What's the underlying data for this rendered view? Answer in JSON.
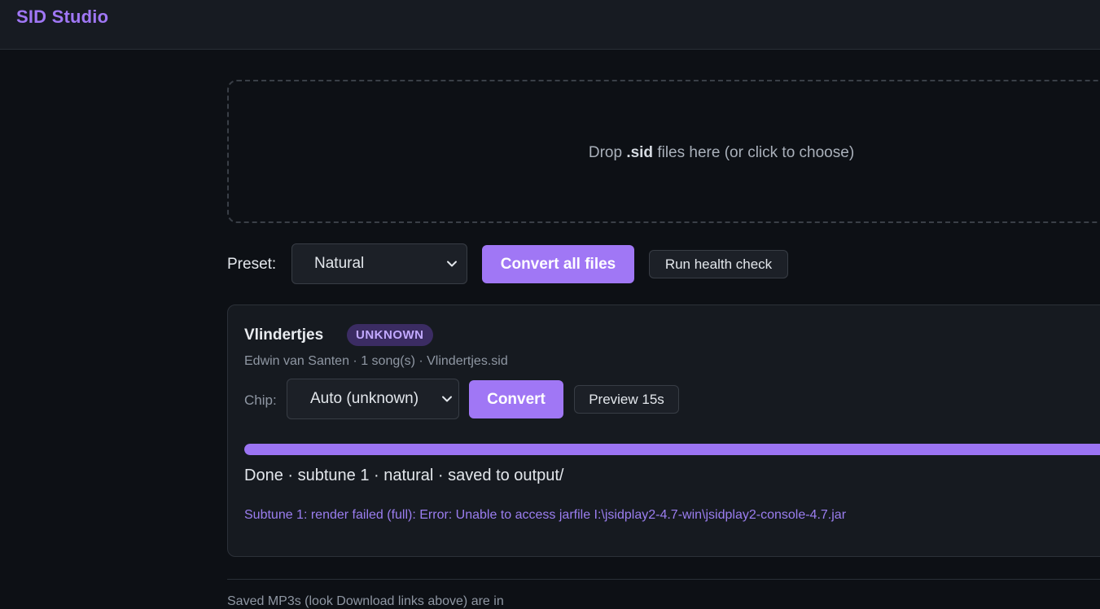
{
  "app": {
    "title": "SID Studio"
  },
  "dropzone": {
    "text_before": "Drop ",
    "text_bold": ".sid",
    "text_after": " files here (or click to choose)"
  },
  "toolbar": {
    "preset_label": "Preset:",
    "preset_value": "Natural",
    "convert_all_label": "Convert all files",
    "health_check_label": "Run health check"
  },
  "file_card": {
    "title": "Vlindertjes",
    "badge": "UNKNOWN",
    "meta": "Edwin van Santen · 1 song(s) · Vlindertjes.sid",
    "chip_label": "Chip:",
    "chip_value": "Auto (unknown)",
    "convert_label": "Convert",
    "preview_label": "Preview 15s",
    "progress": 1.0,
    "status": "Done · subtune 1 · natural · saved to output/",
    "error": "Subtune 1: render failed (full): Error: Unable to access jarfile I:\\jsidplay2-4.7-win\\jsidplay2-console-4.7.jar"
  },
  "footer": {
    "text": "Saved MP3s (look Download links above) are in"
  },
  "colors": {
    "accent": "#a077f5",
    "background": "#0d1015",
    "panel": "#161a20",
    "badge_bg": "#3b2c63",
    "badge_text": "#c2a9ff"
  },
  "icons": {
    "select_chevron": "chevron-down-icon"
  }
}
